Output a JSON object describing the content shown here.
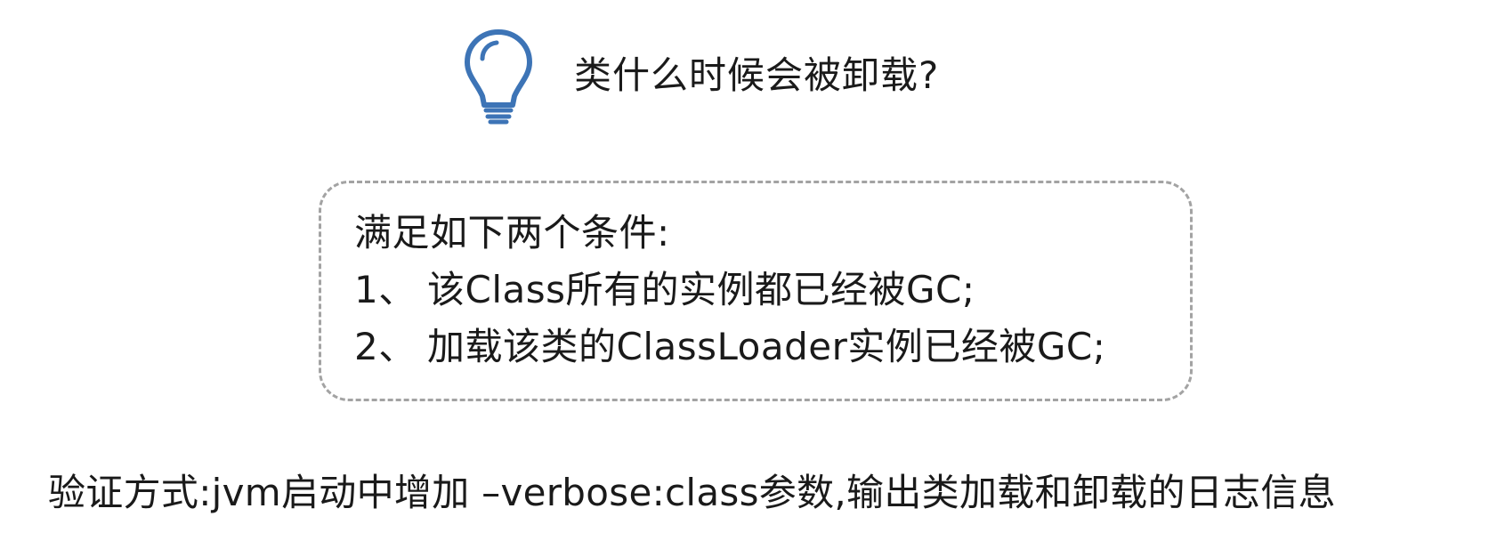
{
  "title": {
    "icon": "lightbulb-icon",
    "text": "类什么时候会被卸载?"
  },
  "conditions": {
    "heading": "满足如下两个条件:",
    "items": [
      {
        "number": "1、",
        "text": "该Class所有的实例都已经被GC;"
      },
      {
        "number": "2、",
        "text": "加载该类的ClassLoader实例已经被GC;"
      }
    ]
  },
  "verification": {
    "text": "验证方式:jvm启动中增加 –verbose:class参数,输出类加载和卸载的日志信息"
  },
  "colors": {
    "icon": "#3d74b6",
    "box_border": "#a3a3a3",
    "text": "#1a1a1a"
  }
}
